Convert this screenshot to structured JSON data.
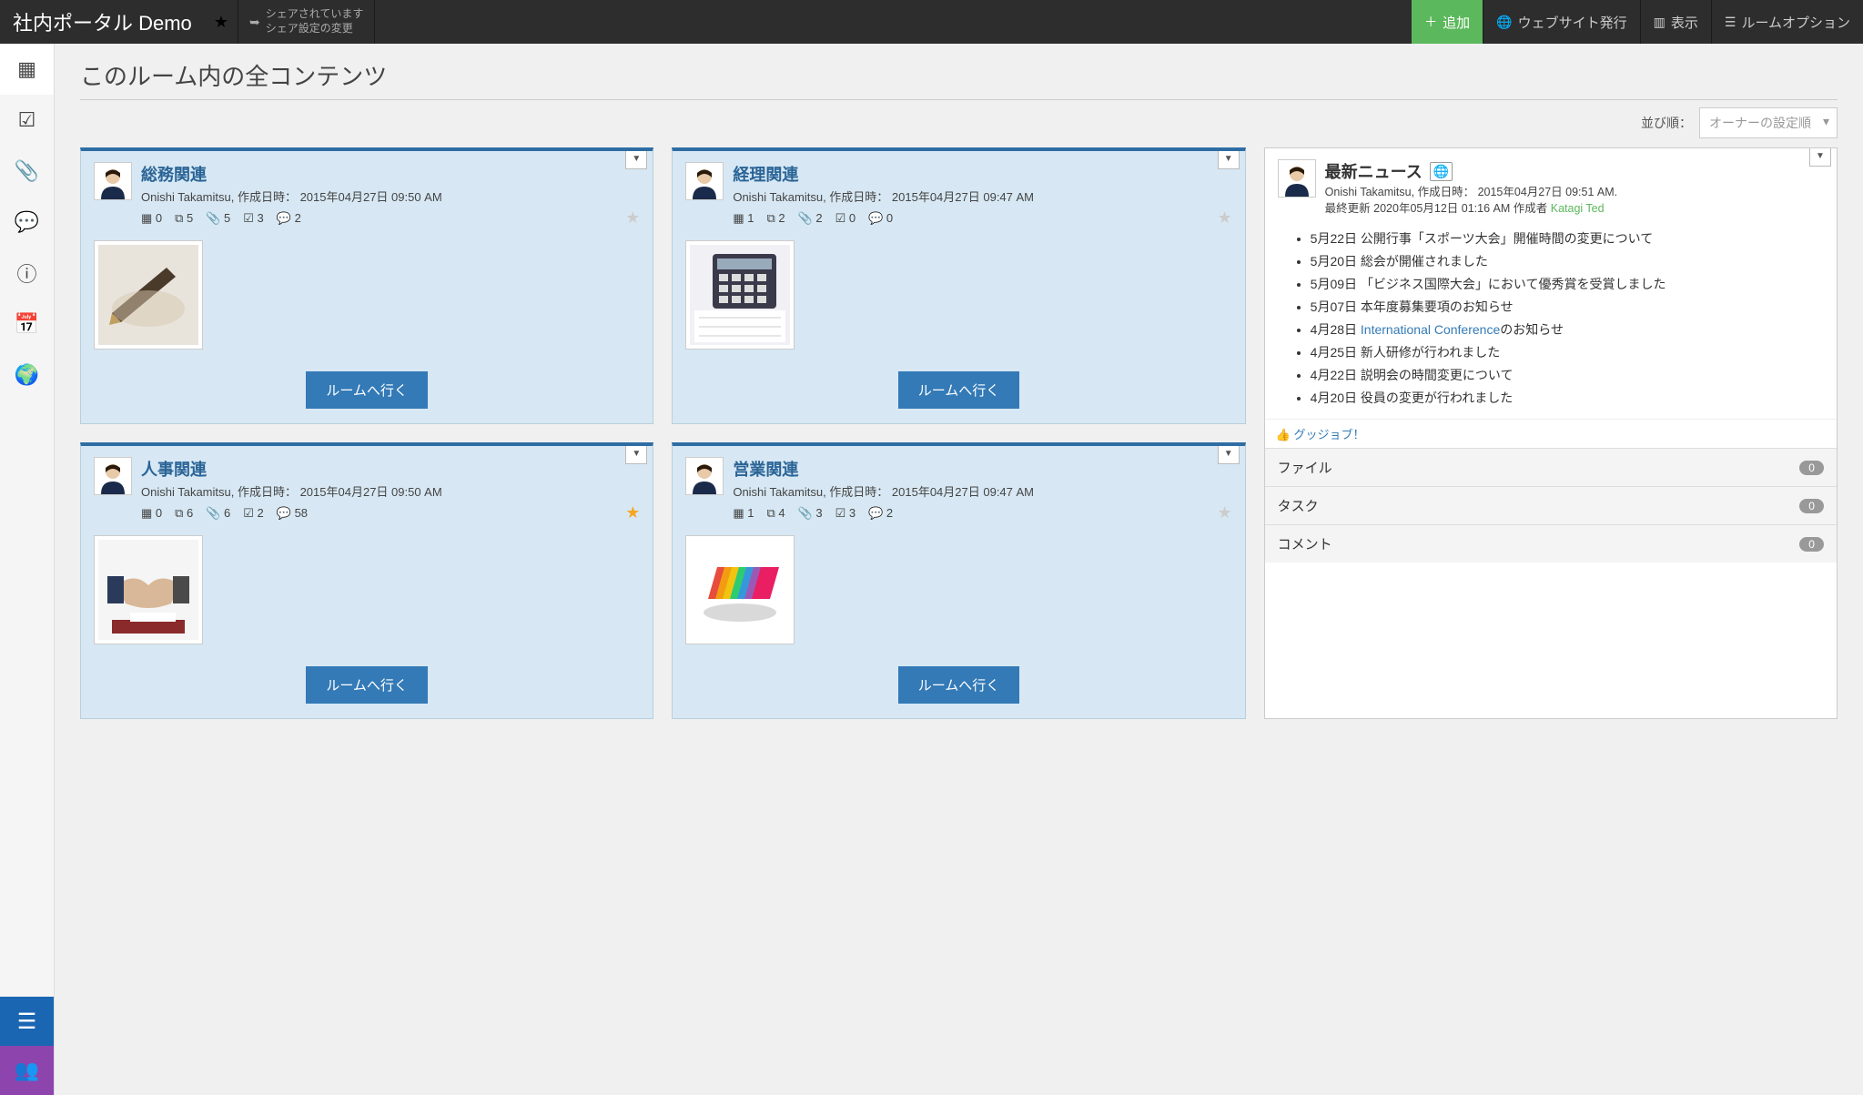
{
  "header": {
    "title": "社内ポータル Demo",
    "share_line1": "シェアされています",
    "share_line2": "シェア設定の変更",
    "add": "追加",
    "publish": "ウェブサイト発行",
    "display": "表示",
    "room_options": "ルームオプション"
  },
  "page": {
    "title": "このルーム内の全コンテンツ",
    "sort_label": "並び順：",
    "sort_value": "オーナーの設定順"
  },
  "cards": [
    {
      "title": "総務関連",
      "author": "Onishi Takamitsu",
      "created_label": "作成日時：",
      "created": "2015年04月27日 09:50 AM",
      "stats": {
        "grid": "0",
        "copy": "5",
        "clip": "5",
        "check": "3",
        "comment": "2"
      },
      "starred": false,
      "button": "ルームへ行く",
      "thumb": "pen"
    },
    {
      "title": "経理関連",
      "author": "Onishi Takamitsu",
      "created_label": "作成日時：",
      "created": "2015年04月27日 09:47 AM",
      "stats": {
        "grid": "1",
        "copy": "2",
        "clip": "2",
        "check": "0",
        "comment": "0"
      },
      "starred": false,
      "button": "ルームへ行く",
      "thumb": "calc"
    },
    {
      "title": "人事関連",
      "author": "Onishi Takamitsu",
      "created_label": "作成日時：",
      "created": "2015年04月27日 09:50 AM",
      "stats": {
        "grid": "0",
        "copy": "6",
        "clip": "6",
        "check": "2",
        "comment": "58"
      },
      "starred": true,
      "button": "ルームへ行く",
      "thumb": "handshake"
    },
    {
      "title": "営業関連",
      "author": "Onishi Takamitsu",
      "created_label": "作成日時：",
      "created": "2015年04月27日 09:47 AM",
      "stats": {
        "grid": "1",
        "copy": "4",
        "clip": "3",
        "check": "3",
        "comment": "2"
      },
      "starred": false,
      "button": "ルームへ行く",
      "thumb": "folders"
    }
  ],
  "news": {
    "title": "最新ニュース",
    "author": "Onishi Takamitsu",
    "created_label": "作成日時：",
    "created": "2015年04月27日 09:51 AM.",
    "updated_prefix": "最終更新",
    "updated": "2020年05月12日 01:16 AM",
    "updated_by_label": "作成者",
    "updated_by": "Katagi Ted",
    "items": [
      {
        "text": "5月22日 公開行事「スポーツ大会」開催時間の変更について"
      },
      {
        "text": "5月20日 総会が開催されました"
      },
      {
        "text": "5月09日 「ビジネス国際大会」において優秀賞を受賞しました"
      },
      {
        "text": "5月07日 本年度募集要項のお知らせ"
      },
      {
        "prefix": "4月28日 ",
        "link": "International Conference",
        "suffix": "のお知らせ"
      },
      {
        "text": "4月25日 新人研修が行われました"
      },
      {
        "text": "4月22日 説明会の時間変更について"
      },
      {
        "text": "4月20日 役員の変更が行われました"
      }
    ],
    "good_job": "グッジョブ！",
    "sections": [
      {
        "label": "ファイル",
        "count": "0"
      },
      {
        "label": "タスク",
        "count": "0"
      },
      {
        "label": "コメント",
        "count": "0"
      }
    ]
  }
}
